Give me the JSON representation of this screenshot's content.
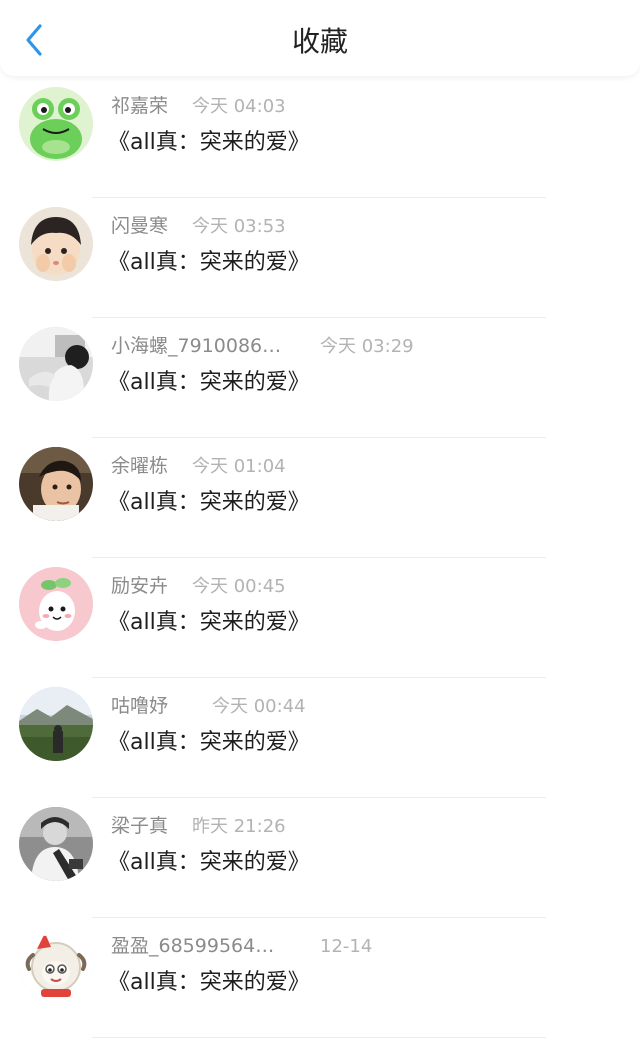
{
  "header": {
    "title": "收藏"
  },
  "favorites": [
    {
      "user": "祁嘉荣",
      "time": "今天 04:03",
      "work": "《all真：突来的爱》",
      "avatar": "frog-avatar-icon"
    },
    {
      "user": "闪曼寒",
      "time": "今天 03:53",
      "work": "《all真：突来的爱》",
      "avatar": "anime-boy-avatar-icon"
    },
    {
      "user": "小海螺_7910086…",
      "time": "今天 03:29",
      "work": "《all真：突来的爱》",
      "avatar": "photo-person-avatar-icon"
    },
    {
      "user": "余曜栋",
      "time": "今天 01:04",
      "work": "《all真：突来的爱》",
      "avatar": "portrait-avatar-icon"
    },
    {
      "user": "励安卉",
      "time": "今天 00:45",
      "work": "《all真：突来的爱》",
      "avatar": "sprout-mascot-avatar-icon"
    },
    {
      "user": "咕噜妤",
      "time": "今天 00:44",
      "work": "《all真：突来的爱》",
      "avatar": "landscape-avatar-icon"
    },
    {
      "user": "梁子真",
      "time": "昨天 21:26",
      "work": "《all真：突来的爱》",
      "avatar": "bw-photo-avatar-icon"
    },
    {
      "user": "盈盈_68599564…",
      "time": "12-14",
      "work": "《all真：突来的爱》",
      "avatar": "sheep-cartoon-avatar-icon"
    }
  ]
}
